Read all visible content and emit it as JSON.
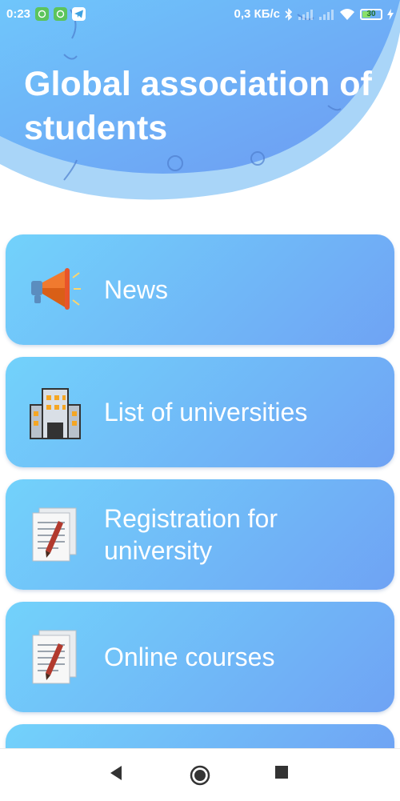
{
  "status_bar": {
    "time": "0:23",
    "speed": "0,3 КБ/с",
    "battery": "30"
  },
  "header": {
    "title": "Global association of students"
  },
  "menu": {
    "items": [
      {
        "label": "News",
        "icon": "megaphone-icon"
      },
      {
        "label": "List of universities",
        "icon": "building-icon"
      },
      {
        "label": "Registration for university",
        "icon": "document-icon"
      },
      {
        "label": "Online courses",
        "icon": "document-icon"
      }
    ]
  },
  "nav": {
    "back": "back-icon",
    "home": "home-icon",
    "recents": "recents-icon"
  },
  "colors": {
    "card_start": "#72d2fb",
    "card_end": "#6fa3f4",
    "header": "#6ea8f6"
  }
}
